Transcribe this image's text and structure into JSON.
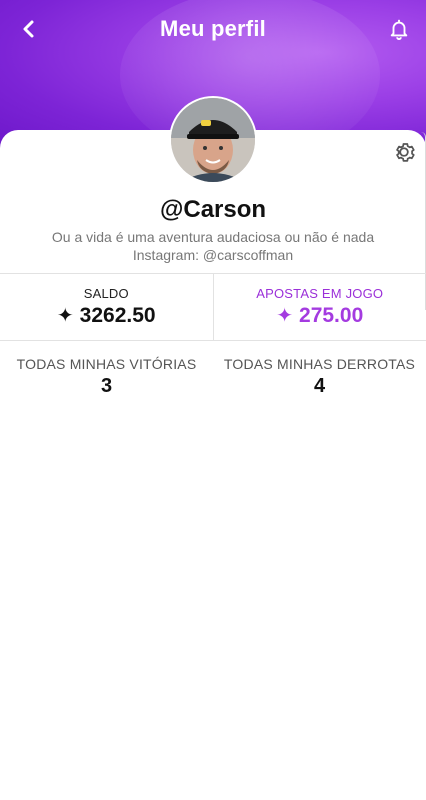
{
  "header": {
    "title": "Meu perfil",
    "accent_color": "#8a2be2"
  },
  "profile": {
    "username": "@Carson",
    "bio_line1": "Ou a vida é uma aventura audaciosa ou não é nada",
    "bio_line2": "Instagram: @carscoffman"
  },
  "stats": {
    "saldo_label": "SALDO",
    "saldo_icon": "sparkle-icon",
    "saldo_value": "3262.50",
    "apostas_label": "APOSTAS EM JOGO",
    "apostas_value": "275.00",
    "apostas_color": "#a43be0"
  },
  "records": {
    "wins_label": "TODAS MINHAS VITÓRIAS",
    "wins_value": "3",
    "losses_label": "TODAS MINHAS DERROTAS",
    "losses_value": "4"
  }
}
